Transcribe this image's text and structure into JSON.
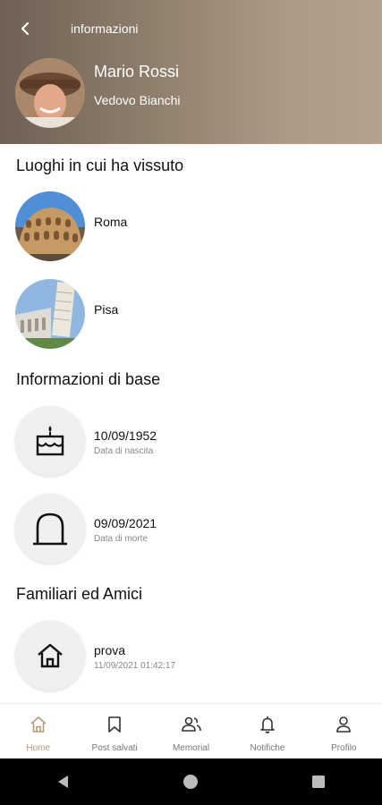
{
  "header": {
    "title": "informazioni",
    "name": "Mario Rossi",
    "subtitle": "Vedovo Bianchi"
  },
  "places": {
    "title": "Luoghi in cui ha vissuto",
    "items": [
      {
        "label": "Roma"
      },
      {
        "label": "Pisa"
      }
    ]
  },
  "basic_info": {
    "title": "Informazioni di base",
    "birth": {
      "date": "10/09/1952",
      "caption": "Data di nascita"
    },
    "death": {
      "date": "09/09/2021",
      "caption": "Data di morte"
    }
  },
  "family": {
    "title": "Familiari ed Amici",
    "items": [
      {
        "label": "prova",
        "timestamp": "11/09/2021 01:42:17"
      }
    ]
  },
  "bottom_nav": {
    "items": [
      {
        "label": "Home",
        "icon": "home-icon",
        "active": true
      },
      {
        "label": "Post salvati",
        "icon": "bookmark-icon"
      },
      {
        "label": "Memorial",
        "icon": "people-icon"
      },
      {
        "label": "Notifiche",
        "icon": "bell-icon"
      },
      {
        "label": "Profilo",
        "icon": "person-icon"
      }
    ]
  },
  "colors": {
    "header_gradient_start": "#6e6154",
    "header_gradient_end": "#b3a28d",
    "nav_active": "#b59a78"
  }
}
